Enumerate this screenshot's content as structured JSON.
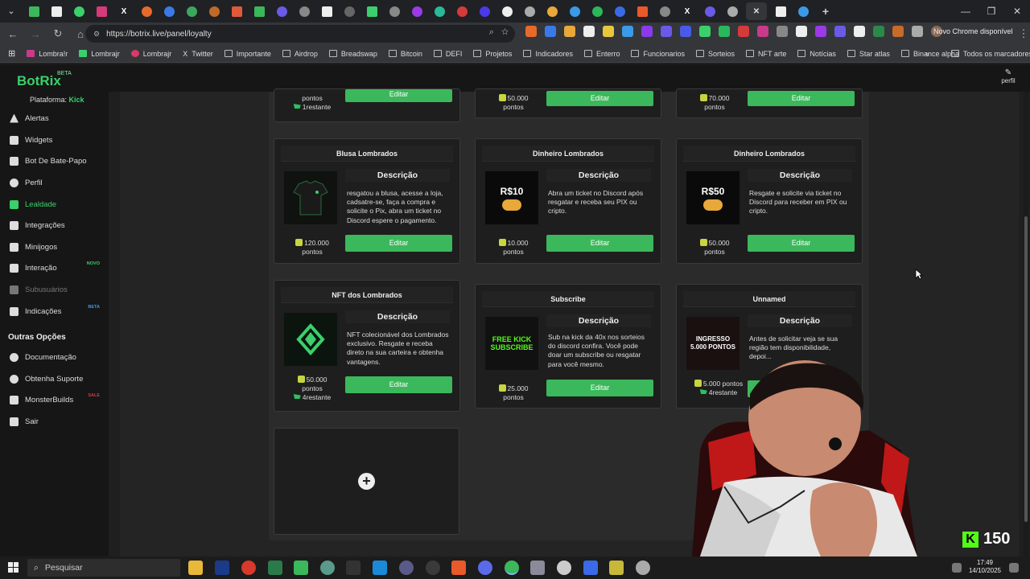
{
  "browser": {
    "url": "https://botrix.live/panel/loyalty",
    "update_label": "Novo Chrome disponível",
    "bookmarks": [
      "Lombra!r",
      "Lombrajr",
      "Lombrajr",
      "Twitter",
      "Importante",
      "Airdrop",
      "Breadswap",
      "Bitcoin",
      "DEFI",
      "Projetos",
      "Indicadores",
      "Enterro",
      "Funcionarios",
      "Sorteios",
      "NFT arte",
      "Notícias",
      "Star atlas",
      "Binance alpha"
    ],
    "all_bookmarks_label": "Todos os marcadores"
  },
  "app": {
    "logo": "BotRix",
    "beta": "BETA",
    "profile_label": "perfil",
    "platform_label": "Plataforma:",
    "platform_value": "Kick"
  },
  "sidebar": {
    "items": [
      {
        "label": "Alertas"
      },
      {
        "label": "Widgets"
      },
      {
        "label": "Bot De Bate-Papo"
      },
      {
        "label": "Perfil"
      },
      {
        "label": "Lealdade"
      },
      {
        "label": "Integrações"
      },
      {
        "label": "Minijogos"
      },
      {
        "label": "Interação",
        "tag": "NOVO"
      },
      {
        "label": "Subusuários"
      },
      {
        "label": "Indicações",
        "tag": "BETA"
      }
    ],
    "other_heading": "Outras Opções",
    "other_items": [
      {
        "label": "Documentação"
      },
      {
        "label": "Obtenha Suporte"
      },
      {
        "label": "MonsterBuilds",
        "tag": "SALE"
      },
      {
        "label": "Sair"
      }
    ]
  },
  "rewards": {
    "edit_label": "Editar",
    "desc_heading": "Descrição",
    "top_row": [
      {
        "price": "pontos",
        "stock": "1restante"
      },
      {
        "price": "50.000",
        "unit": "pontos"
      },
      {
        "price": "70.000",
        "unit": "pontos"
      }
    ],
    "cards": [
      {
        "title": "Blusa Lombrados",
        "desc": "resgatou a blusa, acesse a loja, cadsatre-se, faça a compra e solicite o Pix, abra um ticket no Discord espere o pagamento.",
        "price": "120.000",
        "unit": "pontos"
      },
      {
        "title": "Dinheiro Lombrados",
        "desc": "Abra um ticket no Discord após resgatar e receba seu PIX ou cripto.",
        "price": "10.000",
        "unit": "pontos",
        "img_text": "R$10"
      },
      {
        "title": "Dinheiro Lombrados",
        "desc": "Resgate e solicite via ticket no Discord para receber em PIX ou cripto.",
        "price": "50.000",
        "unit": "pontos",
        "img_text": "R$50"
      },
      {
        "title": "NFT dos Lombrados",
        "desc": "NFT colecionável dos Lombrados exclusivo. Resgate e receba direto na sua carteira e obtenha vantagens.",
        "price": "50.000",
        "unit": "pontos",
        "stock": "4restante"
      },
      {
        "title": "Subscribe",
        "desc": "Sub na kick da 40x nos sorteios do discord confira. Você pode doar um subscribe ou resgatar para você mesmo.",
        "price": "25.000",
        "unit": "pontos",
        "img_text": "FREE KICK SUBSCRIBE"
      },
      {
        "title": "Unnamed",
        "desc": "Antes de solicitar veja se sua região tem disponibilidade, depoi...",
        "price": "5.000 pontos",
        "stock": "4restante",
        "img_text": "INGRESSO 5.000 PONTOS"
      }
    ]
  },
  "taskbar": {
    "search_placeholder": "Pesquisar",
    "time": "17:49",
    "date": "14/10/2025"
  },
  "stream_overlay": {
    "viewer_count": "150"
  },
  "colors": {
    "accent": "#3ad06b",
    "button": "#3bb85b",
    "kick": "#53fc18"
  }
}
